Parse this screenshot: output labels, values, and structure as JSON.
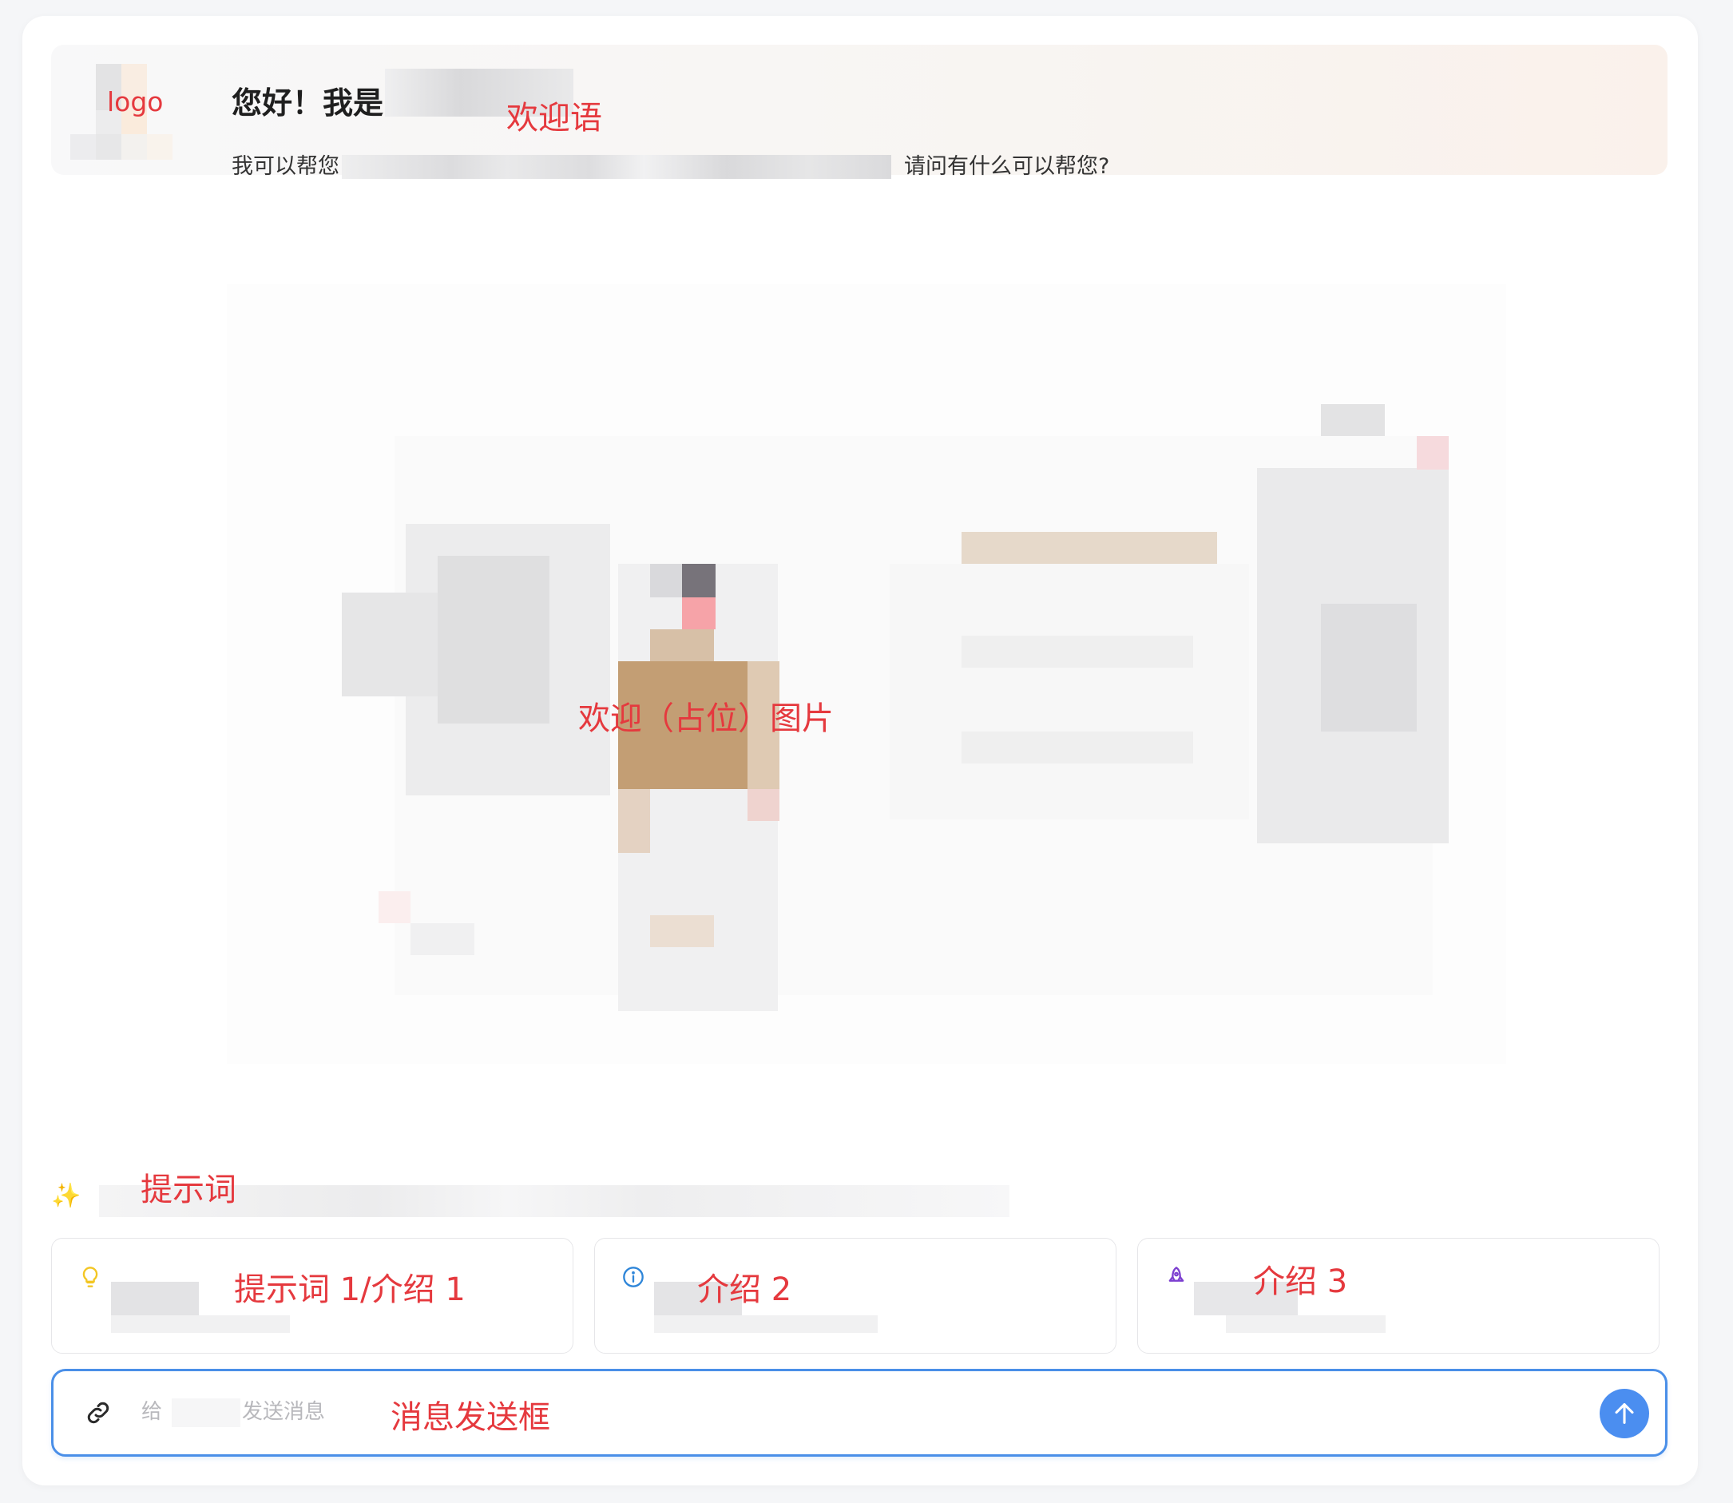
{
  "welcome": {
    "logo_label": "logo",
    "title": "您好！我是",
    "annotation": "欢迎语",
    "prefix": "我可以帮您",
    "suffix": "请问有什么可以帮您?"
  },
  "hero": {
    "annotation": "欢迎（占位）图片"
  },
  "prompts": {
    "sparkle_icon": "sparkles-icon",
    "annotation": "提示词",
    "cards": [
      {
        "icon": "lightbulb-icon",
        "icon_color": "#f3c623",
        "annotation": "提示词 1/介绍 1"
      },
      {
        "icon": "info-circle-icon",
        "icon_color": "#2f86d9",
        "annotation": "介绍 2"
      },
      {
        "icon": "rocket-icon",
        "icon_color": "#7c3fd0",
        "annotation": "介绍 3"
      }
    ]
  },
  "input": {
    "attach_icon": "link-icon",
    "placeholder_pre": "给",
    "placeholder_post": "发送消息",
    "annotation": "消息发送框",
    "send_icon": "arrow-up-icon"
  },
  "colors": {
    "annotation": "#e5393e",
    "accent": "#4a8fe8",
    "send_button": "#4b8ef0"
  }
}
